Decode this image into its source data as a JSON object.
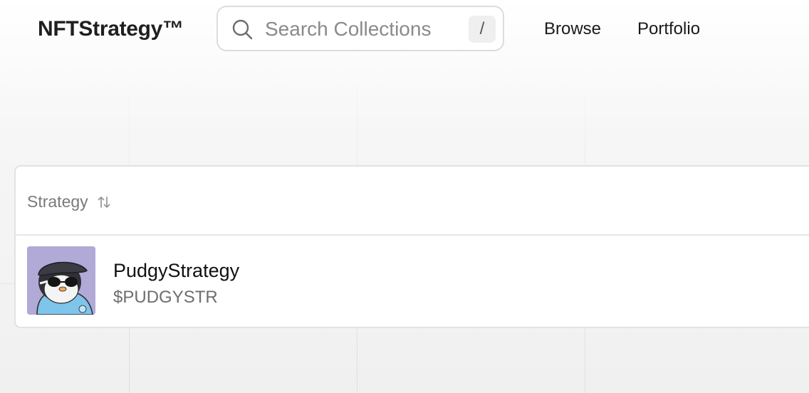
{
  "header": {
    "logo": "NFTStrategy™",
    "search": {
      "placeholder": "Search Collections",
      "shortcut": "/"
    },
    "nav": [
      {
        "label": "Browse"
      },
      {
        "label": "Portfolio"
      }
    ]
  },
  "table": {
    "columns": [
      {
        "label": "Strategy",
        "sort_icon": "sort-arrows-icon"
      }
    ],
    "rows": [
      {
        "name": "PudgyStrategy",
        "ticker": "$PUDGYSTR",
        "avatar_icon": "pudgy-penguin-avatar"
      }
    ]
  },
  "colors": {
    "avatar_bg": "#b1a9d6",
    "text_primary": "#111111",
    "text_muted": "#6e6e6e"
  }
}
